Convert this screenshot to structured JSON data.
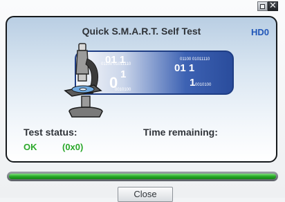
{
  "window": {
    "restore_icon": "restore-icon",
    "close_icon": "close-icon",
    "close_glyph": "✕"
  },
  "panel": {
    "title": "Quick S.M.A.R.T. Self Test",
    "drive": "HD0"
  },
  "graphic": {
    "icon": "microscope-icon",
    "binary": {
      "a": "01 1",
      "b": "01 1",
      "c": "1",
      "d": "0",
      "e": "1",
      "f": "01100 01011110",
      "g": "01100 01011110",
      "h": "0010100",
      "i": "0010100"
    }
  },
  "status": {
    "status_label": "Test status:",
    "time_label": "Time remaining:",
    "status_value": "OK",
    "status_code": "(0x0)"
  },
  "progress": {
    "percent": 100,
    "color": "#22a622"
  },
  "actions": {
    "close_label": "Close"
  }
}
